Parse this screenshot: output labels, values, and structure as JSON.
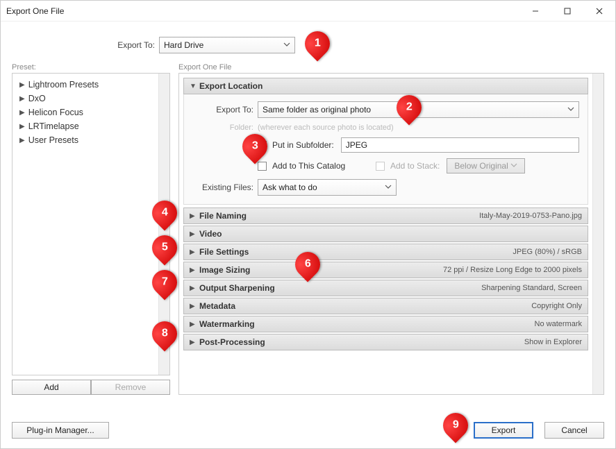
{
  "window": {
    "title": "Export One File"
  },
  "export_to": {
    "label": "Export To:",
    "value": "Hard Drive"
  },
  "preset": {
    "label": "Preset:",
    "items": [
      "Lightroom Presets",
      "DxO",
      "Helicon Focus",
      "LRTimelapse",
      "User Presets"
    ]
  },
  "preset_buttons": {
    "add": "Add",
    "remove": "Remove"
  },
  "right_label": "Export One File",
  "export_location": {
    "title": "Export Location",
    "export_to_label": "Export To:",
    "export_to_value": "Same folder as original photo",
    "folder_label": "Folder:",
    "folder_hint": "(wherever each source photo is located)",
    "put_in_subfolder_label": "Put in Subfolder:",
    "put_in_subfolder_checked": true,
    "subfolder_value": "JPEG",
    "add_to_catalog_label": "Add to This Catalog",
    "add_to_catalog_checked": false,
    "add_to_stack_label": "Add to Stack:",
    "stack_value": "Below Original",
    "existing_files_label": "Existing Files:",
    "existing_files_value": "Ask what to do"
  },
  "sections": {
    "file_naming": {
      "title": "File Naming",
      "summary": "Italy-May-2019-0753-Pano.jpg"
    },
    "video": {
      "title": "Video",
      "summary": ""
    },
    "file_settings": {
      "title": "File Settings",
      "summary": "JPEG (80%) / sRGB"
    },
    "image_sizing": {
      "title": "Image Sizing",
      "summary": "72 ppi / Resize Long Edge to 2000 pixels"
    },
    "output_sharpening": {
      "title": "Output Sharpening",
      "summary": "Sharpening Standard, Screen"
    },
    "metadata": {
      "title": "Metadata",
      "summary": "Copyright Only"
    },
    "watermarking": {
      "title": "Watermarking",
      "summary": "No watermark"
    },
    "post_processing": {
      "title": "Post-Processing",
      "summary": "Show in Explorer"
    }
  },
  "footer": {
    "plugin_manager": "Plug-in Manager...",
    "export": "Export",
    "cancel": "Cancel"
  },
  "callouts": {
    "1": "1",
    "2": "2",
    "3": "3",
    "4": "4",
    "5": "5",
    "6": "6",
    "7": "7",
    "8": "8",
    "9": "9"
  }
}
